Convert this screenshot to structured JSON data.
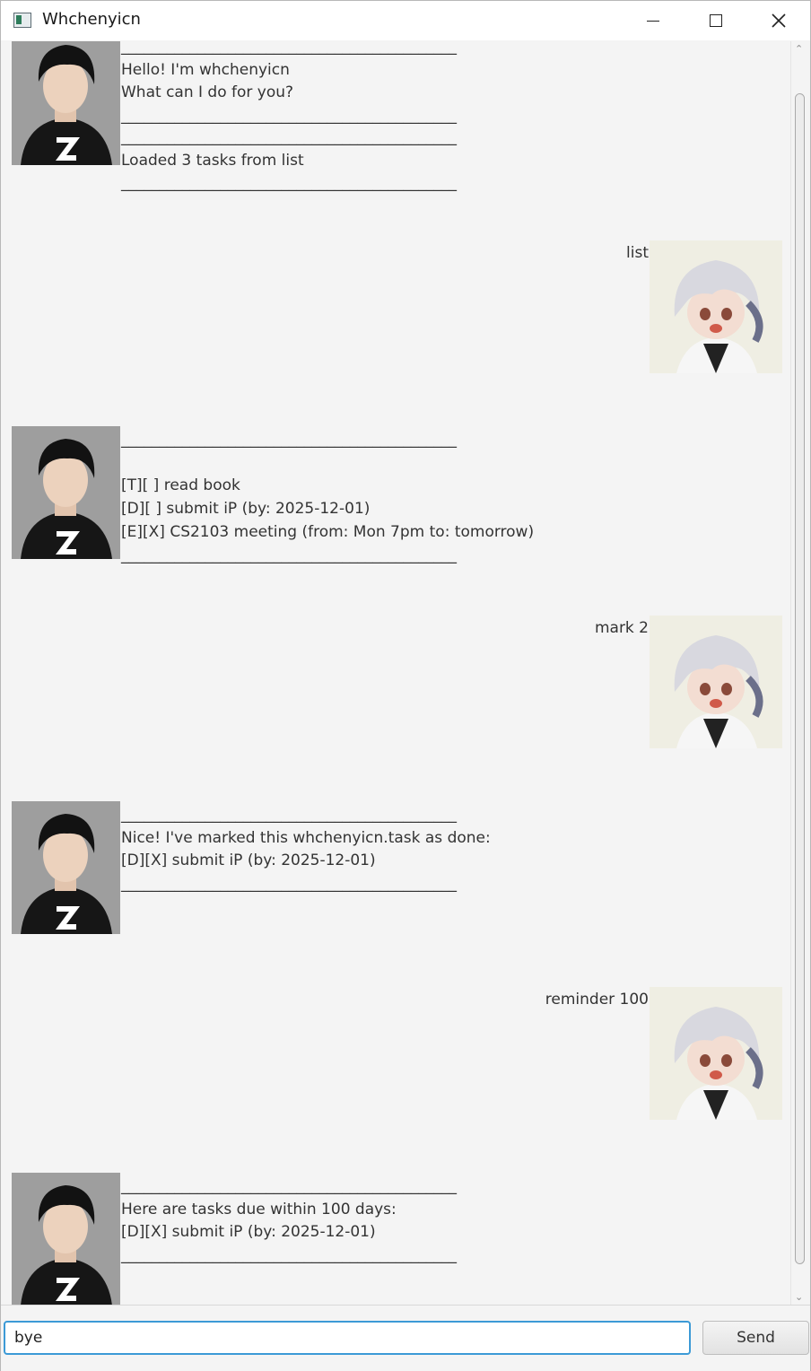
{
  "window": {
    "title": "Whchenyicn"
  },
  "dialog": [
    {
      "speaker": "bot",
      "text": "____________________________________________\nHello! I'm whchenyicn\nWhat can I do for you?\n____________________________________________"
    },
    {
      "speaker": "bot",
      "text": "____________________________________________\nLoaded 3 tasks from list\n____________________________________________"
    },
    {
      "speaker": "user",
      "text": "list"
    },
    {
      "speaker": "bot",
      "text": "____________________________________________\n\n[T][ ] read book\n[D][ ] submit iP (by: 2025-12-01)\n[E][X] CS2103 meeting (from: Mon 7pm to: tomorrow)\n____________________________________________"
    },
    {
      "speaker": "user",
      "text": "mark 2"
    },
    {
      "speaker": "bot",
      "text": "____________________________________________\nNice! I've marked this whchenyicn.task as done:\n[D][X] submit iP (by: 2025-12-01)\n____________________________________________"
    },
    {
      "speaker": "user",
      "text": "reminder 100"
    },
    {
      "speaker": "bot",
      "text": "____________________________________________\nHere are tasks due within 100 days:\n[D][X] submit iP (by: 2025-12-01)\n____________________________________________"
    }
  ],
  "input": {
    "value": "bye"
  },
  "send_label": "Send",
  "icons": {
    "bot_avatar": "bot-avatar-icon",
    "user_avatar": "user-avatar-icon"
  },
  "colors": {
    "accent": "#3c9ad6",
    "background": "#f4f4f4"
  }
}
